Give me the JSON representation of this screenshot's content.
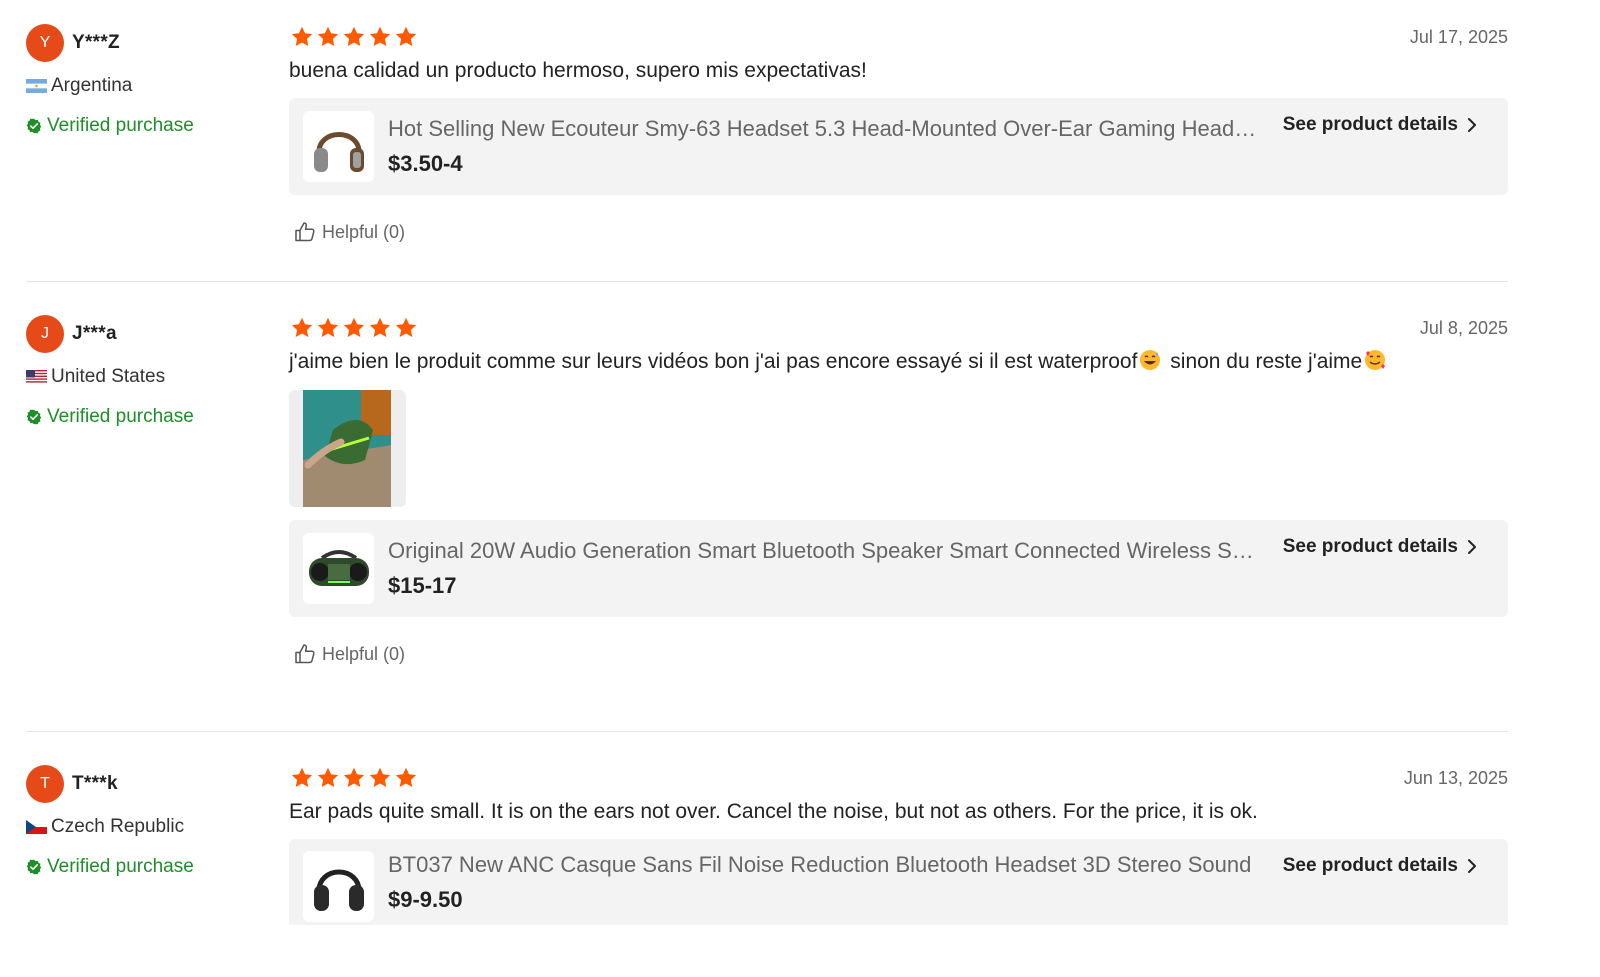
{
  "reviews": [
    {
      "avatar_letter": "Y",
      "username": "Y***Z",
      "country": "Argentina",
      "verified_label": "Verified purchase",
      "stars": 5,
      "date": "Jul 17, 2025",
      "text": "buena calidad un producto hermoso, supero mis expectativas!",
      "product": {
        "title": "Hot Selling New Ecouteur Smy-63 Headset 5.3 Head-Mounted Over-Ear Gaming Headset",
        "price": "$3.50-4",
        "details_label": "See product details"
      },
      "helpful_label": "Helpful (0)"
    },
    {
      "avatar_letter": "J",
      "username": "J***a",
      "country": "United States",
      "verified_label": "Verified purchase",
      "stars": 5,
      "date": "Jul 8, 2025",
      "text_part1": "j'aime bien le produit comme sur leurs vidéos bon j'ai pas encore essayé si il est waterproof",
      "text_part2": " sinon du reste j'aime",
      "product": {
        "title": "Original 20W Audio Generation Smart Bluetooth Speaker Smart Connected Wireless Speaker",
        "price": "$15-17",
        "details_label": "See product details"
      },
      "helpful_label": "Helpful (0)"
    },
    {
      "avatar_letter": "T",
      "username": "T***k",
      "country": "Czech Republic",
      "verified_label": "Verified purchase",
      "stars": 5,
      "date": "Jun 13, 2025",
      "text": "Ear pads quite small. It is on the ears not over. Cancel the noise, but not as others. For the price, it is ok.",
      "product": {
        "title": "BT037 New ANC Casque Sans Fil Noise Reduction Bluetooth Headset 3D Stereo Sound",
        "price": "$9-9.50",
        "details_label": "See product details"
      }
    }
  ],
  "colors": {
    "star": "#ff5a00",
    "avatar": "#e64a19",
    "verified": "#1e8e28"
  },
  "icons": {
    "star": "star-icon",
    "verified": "verified-badge-icon",
    "helpful": "thumbs-up-icon",
    "chevron": "chevron-right-icon"
  }
}
